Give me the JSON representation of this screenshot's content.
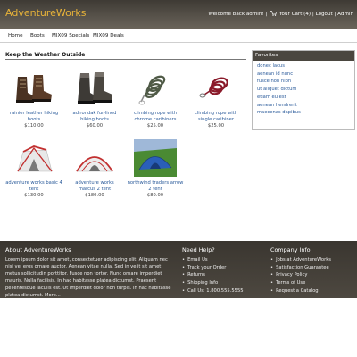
{
  "header": {
    "brand": "AdventureWorks",
    "welcome": "Welcome back admin!",
    "separator": "|",
    "cart": "Your Cart (4)",
    "logout": "Logout",
    "admin": "Admin"
  },
  "nav": {
    "items": [
      {
        "label": "Home"
      },
      {
        "label": "Boots"
      },
      {
        "label": "MIX09 Specials"
      },
      {
        "label": "MIX09 Deals"
      }
    ]
  },
  "main": {
    "section_title": "Keep the Weather Outside",
    "products": [
      {
        "name": "rainier leather hiking boots",
        "price": "$110.00"
      },
      {
        "name": "adirondak fur-lined hiking boots",
        "price": "$60.00"
      },
      {
        "name": "climbing rope with chrome caribiners",
        "price": "$25.00"
      },
      {
        "name": "climbing rope with single caribiner",
        "price": "$25.00"
      },
      {
        "name": "adventure works basic 4 tent",
        "price": "$130.00"
      },
      {
        "name": "adventure works marcus 2 tent",
        "price": "$180.00"
      },
      {
        "name": "northwind traders arrow 2 tent",
        "price": "$80.00"
      }
    ]
  },
  "favorites": {
    "title": "Favorites",
    "items": [
      "donec lacus",
      "aenean id nunc",
      "fusce non nibh",
      "ut aliquet dictum",
      "etiam eu est",
      "aenean hendrerit",
      "maecenas dapibus"
    ]
  },
  "footer": {
    "about_title": "About AdventureWorks",
    "about_text": "Lorem ipsum dolor sit amet, consectetuer adipiscing elit. Aliquam nec nisi vel eros ornare auctor. Aenean vitae nulla. Sed in velit sit amet metus sollicitudin porttitor. Fusce non tortor. Nunc ornare imperdiet mauris. Nulla facilisis. In hac habitasse platea dictumst. Praesent pellentesque iaculis est. Ut imperdiet dolor non turpis. In hac habitasse platea dictumst. More...",
    "help_title": "Need Help?",
    "help_items": [
      "Email Us",
      "Track your Order",
      "Returns",
      "Shipping Info",
      "Call Us: 1.800.555.5555"
    ],
    "company_title": "Company Info",
    "company_items": [
      "Jobs at AdventureWorks",
      "Satisfaction Guarantee",
      "Privacy Policy",
      "Terms of Use",
      "Request a Catalog"
    ]
  },
  "colors": {
    "brand": "#e8b339",
    "link": "#2a5a9a",
    "header_bg": "#4e4941",
    "footer_bg": "#3f3b34"
  }
}
